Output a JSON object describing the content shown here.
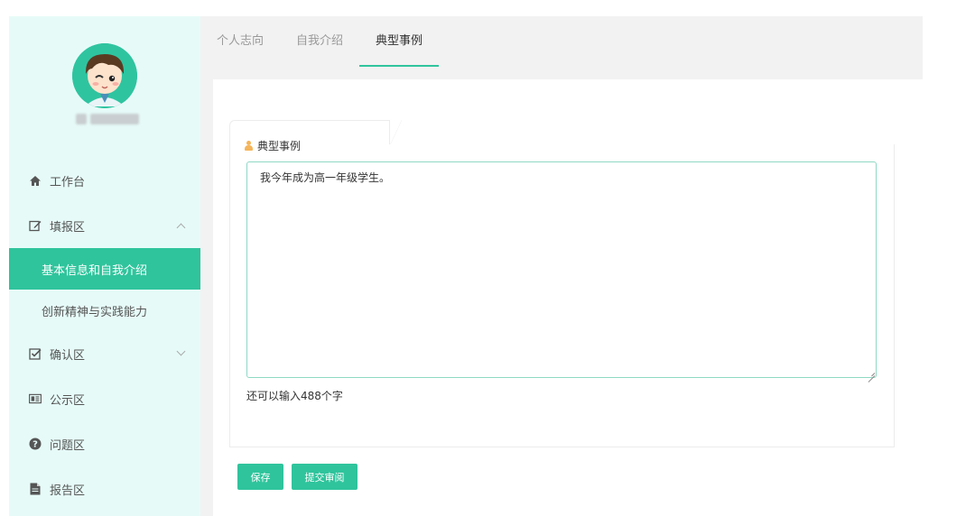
{
  "sidebar": {
    "menu": [
      {
        "label": "工作台",
        "icon": "home-icon"
      },
      {
        "label": "填报区",
        "icon": "edit-icon",
        "expanded": true,
        "children": [
          {
            "label": "基本信息和自我介绍",
            "active": true
          },
          {
            "label": "创新精神与实践能力",
            "active": false
          }
        ]
      },
      {
        "label": "确认区",
        "icon": "checkbox-icon",
        "expanded": false
      },
      {
        "label": "公示区",
        "icon": "board-icon"
      },
      {
        "label": "问题区",
        "icon": "question-icon"
      },
      {
        "label": "报告区",
        "icon": "file-icon"
      }
    ]
  },
  "tabs": [
    {
      "label": "个人志向",
      "active": false
    },
    {
      "label": "自我介绍",
      "active": false
    },
    {
      "label": "典型事例",
      "active": true
    }
  ],
  "form": {
    "section_label": "典型事例",
    "textarea_value": "我今年成为高一年级学生。",
    "counter_text": "还可以输入488个字",
    "save_label": "保存",
    "submit_label": "提交审阅"
  },
  "colors": {
    "accent": "#2fc49c",
    "sidebar_bg": "#e6fbf8",
    "tabbar_bg": "#f2f2f2",
    "textarea_border": "#8fd9c4",
    "label_icon": "#f5b55a"
  }
}
